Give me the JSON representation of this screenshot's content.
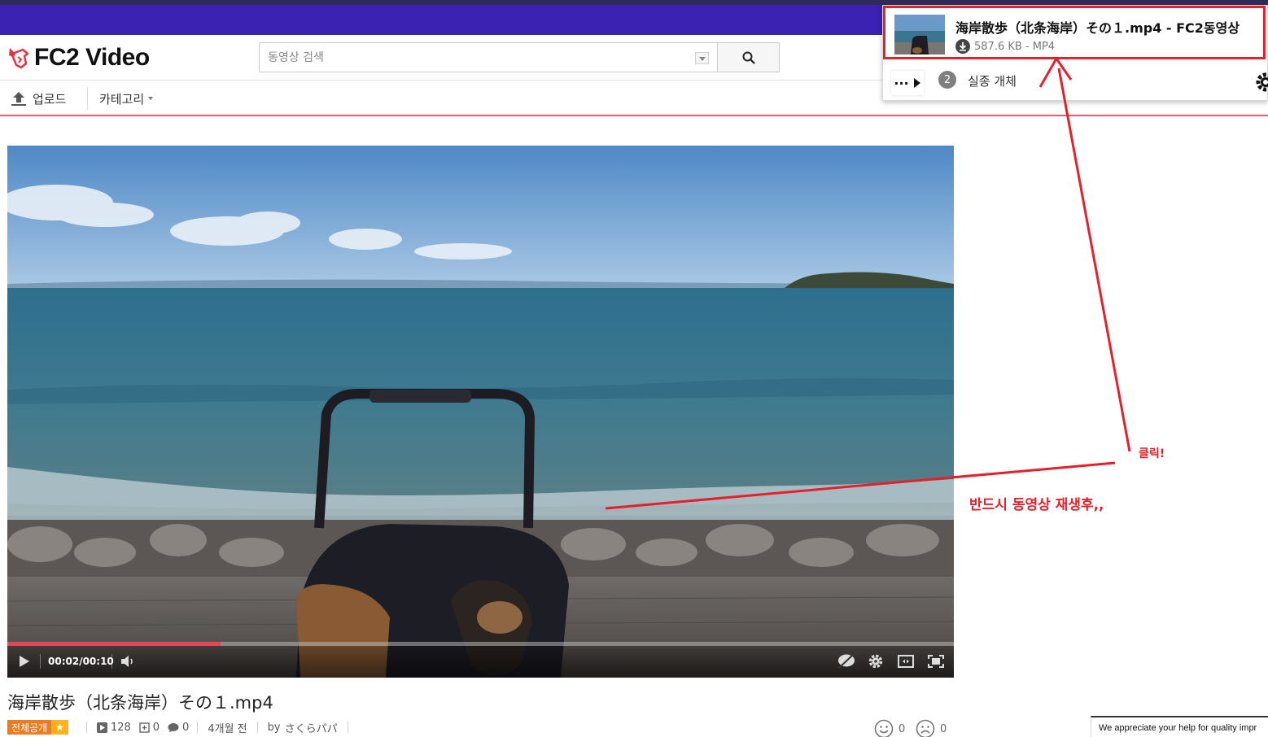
{
  "header": {
    "logo_text": "FC2 Video",
    "search_placeholder": "동영상 검색"
  },
  "nav": {
    "upload_label": "업로드",
    "category_label": "카테고리"
  },
  "player": {
    "time_display": "00:02/00:10",
    "progress_fraction": 0.225
  },
  "video": {
    "title": "海岸散歩（北条海岸）その１.mp4",
    "visibility_badge": "전체공개",
    "star": "★",
    "views": "128",
    "additions": "0",
    "comments": "0",
    "age": "4개월 전",
    "by_label": "by",
    "author": "さくらパパ",
    "likes": "0",
    "dislikes": "0"
  },
  "download_popup": {
    "title": "海岸散歩（北条海岸）その１.mp4 - FC2동영상",
    "file_info": "587.6 KB - MP4",
    "more_label": "···",
    "variants_count": "2",
    "variants_label": "실종 개체"
  },
  "annotations": {
    "click_note": "클릭!",
    "play_first_note": "반드시 동영상 재생후,,",
    "color": "#e5202a"
  },
  "feedback": {
    "text": "We appreciate your help for quality impr"
  },
  "colors": {
    "topbar": "#3b22b2",
    "accent_red": "#e2485a",
    "badge_orange": "#f07a1e"
  }
}
